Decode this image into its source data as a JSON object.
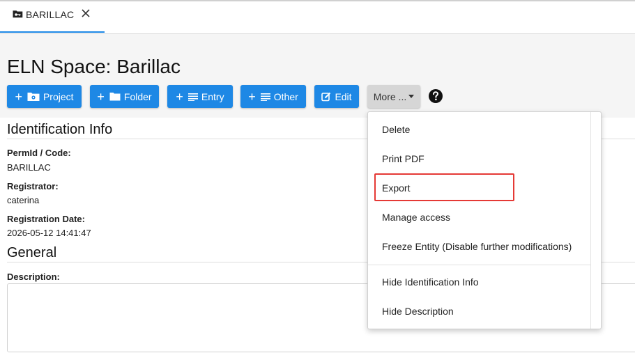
{
  "tabs": [
    {
      "label": "BARILLAC",
      "icon": "folder-key-icon",
      "close_icon": "close-icon"
    }
  ],
  "page": {
    "title": "ELN Space: Barillac"
  },
  "toolbar": {
    "project_label": "Project",
    "folder_label": "Folder",
    "entry_label": "Entry",
    "other_label": "Other",
    "edit_label": "Edit",
    "more_label": "More ...",
    "accent_color": "#1e88e5"
  },
  "identification": {
    "title": "Identification Info",
    "permid_label": "PermId / Code:",
    "permid_value": "BARILLAC",
    "registrator_label": "Registrator:",
    "registrator_value": "caterina",
    "registration_date_label": "Registration Date:",
    "registration_date_value": "2026-05-12 14:41:47"
  },
  "general": {
    "title": "General",
    "description_label": "Description:",
    "description_value": ""
  },
  "more_menu": {
    "items": [
      "Delete",
      "Print PDF",
      "Export",
      "Manage access",
      "Freeze Entity (Disable further modifications)",
      "Hide Identification Info",
      "Hide Description"
    ],
    "highlighted_item": "Export",
    "highlight_color": "#e53935"
  }
}
